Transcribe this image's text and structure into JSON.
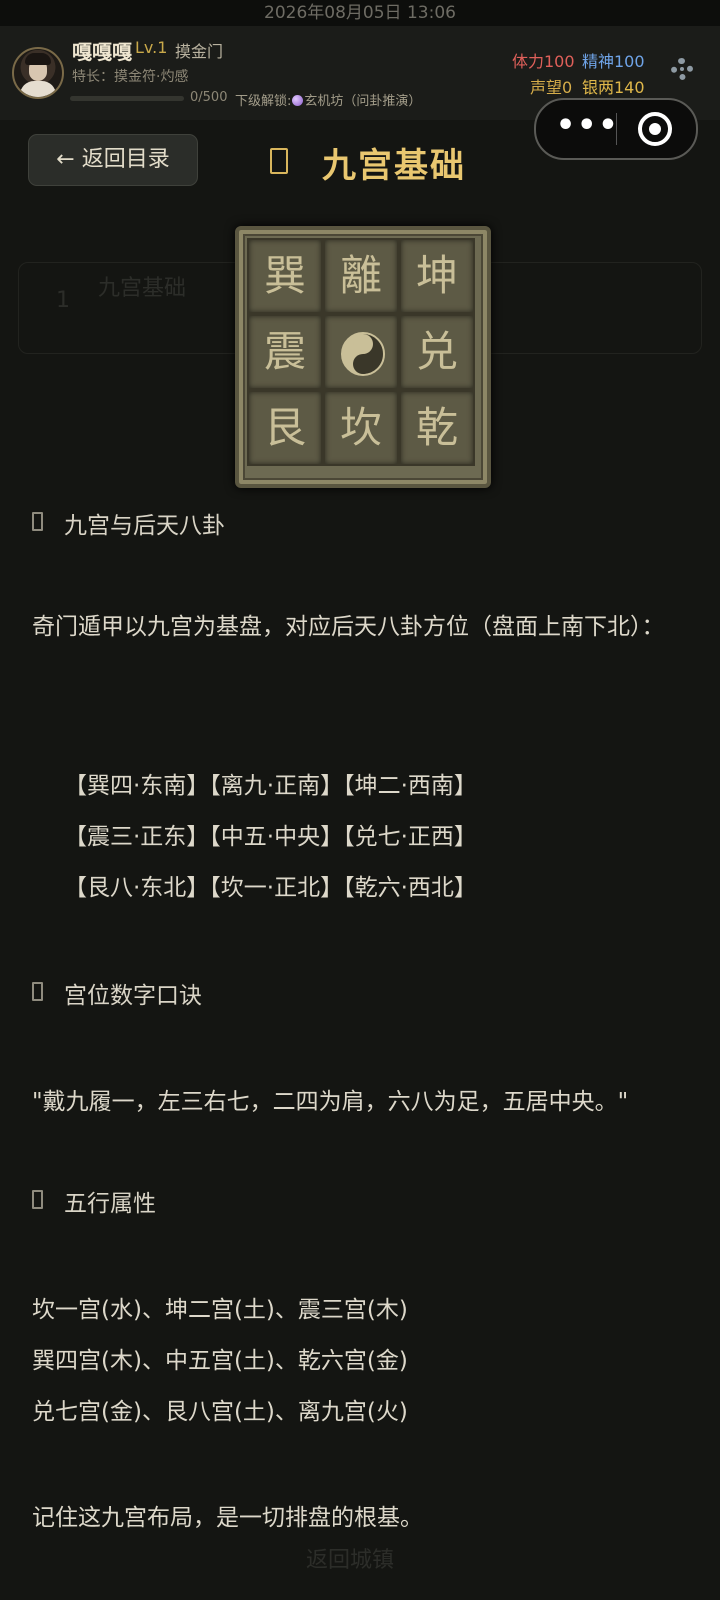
{
  "status_bar": {
    "datetime": "2026年08月05日 13:06"
  },
  "player": {
    "name": "嘎嘎嘎",
    "level": "Lv.1",
    "sect": "摸金门",
    "specialty": "特长：摸金符·灼感",
    "xp": {
      "current_text": "0/500",
      "fraction": 0.0
    },
    "unlock": {
      "prefix": "下级解锁:",
      "target": "玄机坊（问卦推演）"
    }
  },
  "stats": {
    "stamina": "体力100",
    "spirit": "精神100",
    "reputation": "声望0",
    "silver": "银两140"
  },
  "nav": {
    "back_label": "← 返回目录",
    "title": "九宫基础"
  },
  "ghost_layer": {
    "card_title": "九宫基础",
    "card_badge": "1",
    "bottom_button": "返回城镇"
  },
  "seal": {
    "rows": [
      [
        "巽",
        "離",
        "坤"
      ],
      [
        "震",
        "",
        "兑"
      ],
      [
        "艮",
        "坎",
        "乾"
      ]
    ]
  },
  "content": {
    "section1": {
      "heading": "九宫与后天八卦",
      "intro": "奇门遁甲以九宫为基盘，对应后天八卦方位（盘面上南下北）：",
      "rows": [
        "【巽四·东南】【离九·正南】【坤二·西南】",
        "【震三·正东】【中五·中央】【兑七·正西】",
        "【艮八·东北】【坎一·正北】【乾六·西北】"
      ]
    },
    "section2": {
      "heading": "宫位数字口诀",
      "verse": "\"戴九履一，左三右七，二四为肩，六八为足，五居中央。\""
    },
    "section3": {
      "heading": "五行属性",
      "lines": [
        "坎一宫(水)、坤二宫(土)、震三宫(木)",
        "巽四宫(木)、中五宫(土)、乾六宫(金)",
        "兑七宫(金)、艮八宫(土)、离九宫(火)"
      ]
    },
    "closing": "记住这九宫布局，是一切排盘的根基。"
  },
  "colors": {
    "background": "#141512",
    "title_gold": "#e9c770",
    "stamina_red": "#e0605a",
    "spirit_blue": "#6fa4e8",
    "reputation_gold": "#d6ad4a"
  }
}
